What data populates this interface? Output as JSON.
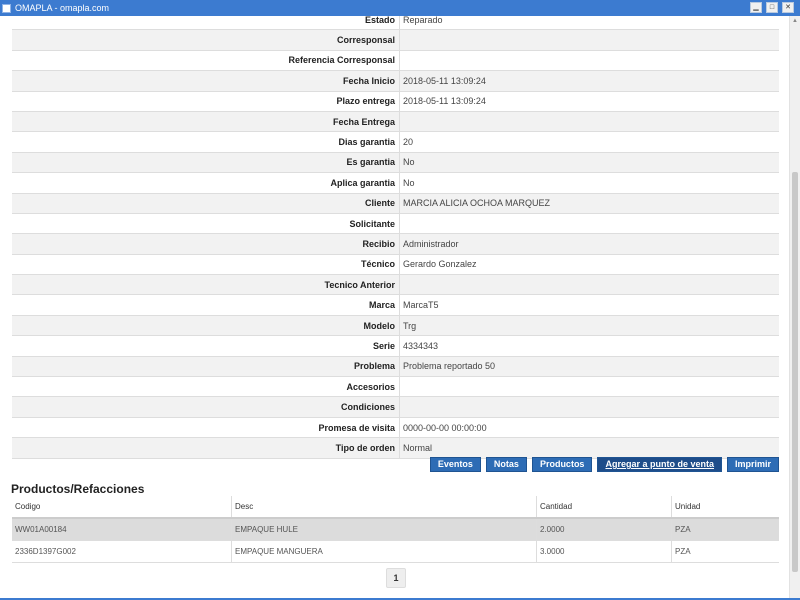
{
  "window": {
    "title": "OMAPLA - omapla.com",
    "controls": [
      "minimize-icon",
      "maximize-icon",
      "close-icon"
    ]
  },
  "details": [
    {
      "label": "Estado",
      "value": "Reparado"
    },
    {
      "label": "Corresponsal",
      "value": ""
    },
    {
      "label": "Referencia Corresponsal",
      "value": ""
    },
    {
      "label": "Fecha Inicio",
      "value": "2018-05-11 13:09:24"
    },
    {
      "label": "Plazo entrega",
      "value": "2018-05-11 13:09:24"
    },
    {
      "label": "Fecha Entrega",
      "value": ""
    },
    {
      "label": "Dias garantia",
      "value": "20"
    },
    {
      "label": "Es garantia",
      "value": "No"
    },
    {
      "label": "Aplica garantia",
      "value": "No"
    },
    {
      "label": "Cliente",
      "value": "MARCIA ALICIA OCHOA MARQUEZ"
    },
    {
      "label": "Solicitante",
      "value": ""
    },
    {
      "label": "Recibio",
      "value": "Administrador"
    },
    {
      "label": "Técnico",
      "value": "Gerardo Gonzalez"
    },
    {
      "label": "Tecnico Anterior",
      "value": ""
    },
    {
      "label": "Marca",
      "value": "MarcaT5"
    },
    {
      "label": "Modelo",
      "value": "Trg"
    },
    {
      "label": "Serie",
      "value": "4334343"
    },
    {
      "label": "Problema",
      "value": "Problema reportado 50"
    },
    {
      "label": "Accesorios",
      "value": ""
    },
    {
      "label": "Condiciones",
      "value": ""
    },
    {
      "label": "Promesa de visita",
      "value": "0000-00-00 00:00:00"
    },
    {
      "label": "Tipo de orden",
      "value": "Normal"
    }
  ],
  "buttons": {
    "eventos": "Eventos",
    "notas": "Notas",
    "productos": "Productos",
    "agregar": "Agregar a punto de venta",
    "imprimir": "Imprimir"
  },
  "products_section": {
    "title": "Productos/Refacciones",
    "columns": [
      "Codigo",
      "Desc",
      "Cantidad",
      "Unidad"
    ],
    "rows": [
      {
        "codigo": "WW01A00184",
        "desc": "EMPAQUE HULE",
        "cantidad": "2.0000",
        "unidad": "PZA"
      },
      {
        "codigo": "2336D1397G002",
        "desc": "EMPAQUE MANGUERA",
        "cantidad": "3.0000",
        "unidad": "PZA"
      }
    ]
  },
  "pagination": {
    "current_page": "1"
  },
  "colors": {
    "titlebar": "#3c7bd0",
    "button": "#2d6cb5",
    "button_dark": "#1e4d8a",
    "selected_row": "#dcdcdc"
  }
}
